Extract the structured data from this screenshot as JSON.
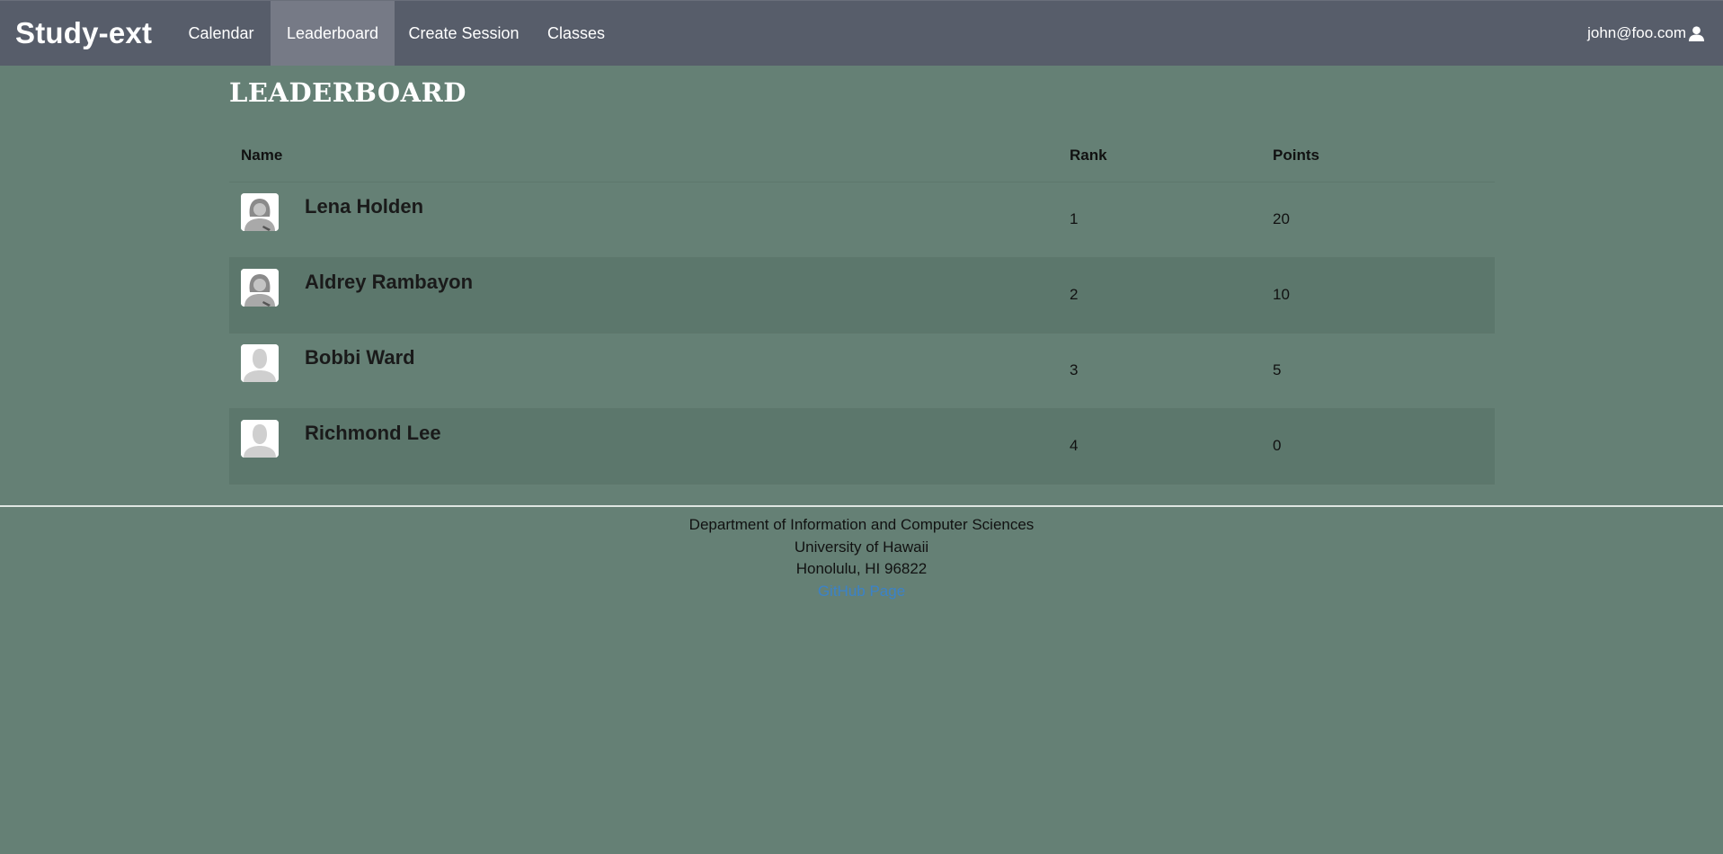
{
  "navbar": {
    "brand": "Study-ext",
    "items": [
      {
        "label": "Calendar",
        "active": false
      },
      {
        "label": "Leaderboard",
        "active": true
      },
      {
        "label": "Create Session",
        "active": false
      },
      {
        "label": "Classes",
        "active": false
      }
    ],
    "user_email": "john@foo.com",
    "user_icon": "user-icon"
  },
  "page": {
    "title": "LEADERBOARD"
  },
  "leaderboard": {
    "columns": [
      "Name",
      "Rank",
      "Points"
    ],
    "rows": [
      {
        "name": "Lena Holden",
        "rank": "1",
        "points": "20",
        "avatar": "female-avatar-icon"
      },
      {
        "name": "Aldrey Rambayon",
        "rank": "2",
        "points": "10",
        "avatar": "female-avatar-icon"
      },
      {
        "name": "Bobbi Ward",
        "rank": "3",
        "points": "5",
        "avatar": "default-avatar-icon"
      },
      {
        "name": "Richmond Lee",
        "rank": "4",
        "points": "0",
        "avatar": "default-avatar-icon"
      }
    ]
  },
  "footer": {
    "lines": [
      "Department of Information and Computer Sciences",
      "University of Hawaii",
      "Honolulu, HI 96822"
    ],
    "link_label": "GitHub Page"
  },
  "colors": {
    "navbar_bg": "#575d6a",
    "navbar_active_bg": "#767a86",
    "page_bg": "#658075",
    "row_alt_bg": "#5c776c",
    "link": "#3b82c8"
  }
}
